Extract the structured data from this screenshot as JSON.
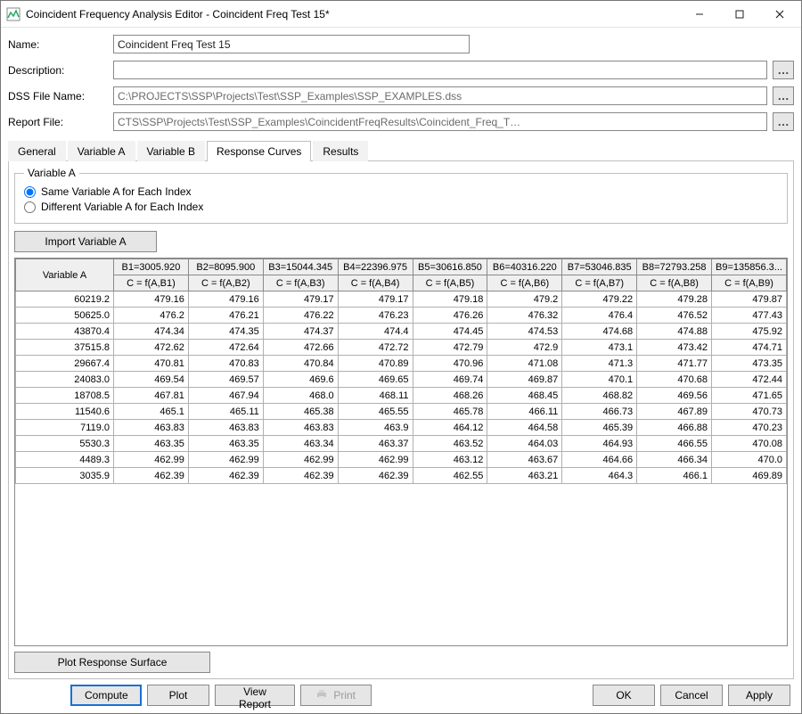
{
  "window": {
    "title": "Coincident Frequency Analysis Editor - Coincident Freq Test 15*"
  },
  "form": {
    "name_label": "Name:",
    "name_value": "Coincident Freq Test 15",
    "desc_label": "Description:",
    "desc_value": "",
    "dss_label": "DSS File Name:",
    "dss_value": "C:\\PROJECTS\\SSP\\Projects\\Test\\SSP_Examples\\SSP_EXAMPLES.dss",
    "report_label": "Report File:",
    "report_value": "CTS\\SSP\\Projects\\Test\\SSP_Examples\\CoincidentFreqResults\\Coincident_Freq_T…",
    "browse_glyph": "…"
  },
  "tabs": {
    "items": [
      "General",
      "Variable A",
      "Variable B",
      "Response Curves",
      "Results"
    ],
    "active_index": 3
  },
  "varA": {
    "legend": "Variable A",
    "radio_same": "Same Variable A for Each Index",
    "radio_diff": "Different Variable A for Each Index",
    "selected": "same",
    "import_btn": "Import Variable A"
  },
  "grid": {
    "corner_label": "Variable A",
    "b_headers": [
      "B1=3005.920",
      "B2=8095.900",
      "B3=15044.345",
      "B4=22396.975",
      "B5=30616.850",
      "B6=40316.220",
      "B7=53046.835",
      "B8=72793.258",
      "B9=135856.3..."
    ],
    "c_headers": [
      "C = f(A,B1)",
      "C = f(A,B2)",
      "C = f(A,B3)",
      "C = f(A,B4)",
      "C = f(A,B5)",
      "C = f(A,B6)",
      "C = f(A,B7)",
      "C = f(A,B8)",
      "C = f(A,B9)"
    ],
    "rows": [
      {
        "a": "60219.2",
        "v": [
          "479.16",
          "479.16",
          "479.17",
          "479.17",
          "479.18",
          "479.2",
          "479.22",
          "479.28",
          "479.87"
        ]
      },
      {
        "a": "50625.0",
        "v": [
          "476.2",
          "476.21",
          "476.22",
          "476.23",
          "476.26",
          "476.32",
          "476.4",
          "476.52",
          "477.43"
        ]
      },
      {
        "a": "43870.4",
        "v": [
          "474.34",
          "474.35",
          "474.37",
          "474.4",
          "474.45",
          "474.53",
          "474.68",
          "474.88",
          "475.92"
        ]
      },
      {
        "a": "37515.8",
        "v": [
          "472.62",
          "472.64",
          "472.66",
          "472.72",
          "472.79",
          "472.9",
          "473.1",
          "473.42",
          "474.71"
        ]
      },
      {
        "a": "29667.4",
        "v": [
          "470.81",
          "470.83",
          "470.84",
          "470.89",
          "470.96",
          "471.08",
          "471.3",
          "471.77",
          "473.35"
        ]
      },
      {
        "a": "24083.0",
        "v": [
          "469.54",
          "469.57",
          "469.6",
          "469.65",
          "469.74",
          "469.87",
          "470.1",
          "470.68",
          "472.44"
        ]
      },
      {
        "a": "18708.5",
        "v": [
          "467.81",
          "467.94",
          "468.0",
          "468.11",
          "468.26",
          "468.45",
          "468.82",
          "469.56",
          "471.65"
        ]
      },
      {
        "a": "11540.6",
        "v": [
          "465.1",
          "465.11",
          "465.38",
          "465.55",
          "465.78",
          "466.11",
          "466.73",
          "467.89",
          "470.73"
        ]
      },
      {
        "a": "7119.0",
        "v": [
          "463.83",
          "463.83",
          "463.83",
          "463.9",
          "464.12",
          "464.58",
          "465.39",
          "466.88",
          "470.23"
        ]
      },
      {
        "a": "5530.3",
        "v": [
          "463.35",
          "463.35",
          "463.34",
          "463.37",
          "463.52",
          "464.03",
          "464.93",
          "466.55",
          "470.08"
        ]
      },
      {
        "a": "4489.3",
        "v": [
          "462.99",
          "462.99",
          "462.99",
          "462.99",
          "463.12",
          "463.67",
          "464.66",
          "466.34",
          "470.0"
        ]
      },
      {
        "a": "3035.9",
        "v": [
          "462.39",
          "462.39",
          "462.39",
          "462.39",
          "462.55",
          "463.21",
          "464.3",
          "466.1",
          "469.89"
        ]
      }
    ]
  },
  "buttons": {
    "plot_surface": "Plot Response Surface",
    "compute": "Compute",
    "plot": "Plot",
    "view_report": "View Report",
    "print": "Print",
    "ok": "OK",
    "cancel": "Cancel",
    "apply": "Apply"
  }
}
